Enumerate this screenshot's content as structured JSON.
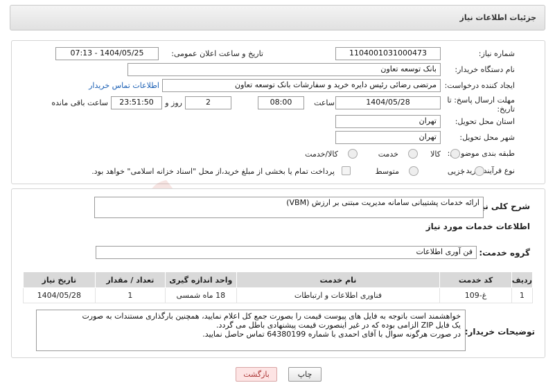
{
  "header": {
    "title": "جزئیات اطلاعات نیاز"
  },
  "form": {
    "need_number_label": "شماره نیاز:",
    "need_number": "1104001031000473",
    "announce_label": "تاریخ و ساعت اعلان عمومی:",
    "announce_value": "1404/05/25 - 07:13",
    "buyer_org_label": "نام دستگاه خریدار:",
    "buyer_org": "بانک توسعه تعاون",
    "requester_label": "ایجاد کننده درخواست:",
    "requester": "مرتضی رضائی رئیس دایره خرید و سفارشات بانک توسعه تعاون",
    "contact_link": "اطلاعات تماس خریدار",
    "deadline_label_1": "مهلت ارسال پاسخ: تا",
    "deadline_label_2": "تاریخ:",
    "deadline_date": "1404/05/28",
    "time_label": "ساعت",
    "deadline_time": "08:00",
    "days_value": "2",
    "days_label": "روز و",
    "remaining_time": "23:51:50",
    "remaining_label": "ساعت باقی مانده",
    "province_label": "استان محل تحویل:",
    "province": "تهران",
    "city_label": "شهر محل تحویل:",
    "city": "تهران",
    "category_label": "طبقه بندی موضوعی:",
    "category_options": [
      "کالا",
      "خدمت",
      "کالا/خدمت"
    ],
    "process_label": "نوع فرآیند خرید :",
    "process_options": [
      "جزیی",
      "متوسط"
    ],
    "payment_text": "پرداخت تمام یا بخشی از مبلغ خرید،از محل \"اسناد خزانه اسلامی\" خواهد بود."
  },
  "details": {
    "general_desc_label": "شرح کلی نیاز:",
    "general_desc": "ارائه خدمات پشتیبانی سامانه مدیریت مبتنی بر ارزش (VBM)",
    "services_info_title": "اطلاعات خدمات مورد نیاز",
    "service_group_label": "گروه خدمت:",
    "service_group": "فن آوری اطلاعات"
  },
  "table": {
    "headers": [
      "ردیف",
      "کد خدمت",
      "نام خدمت",
      "واحد اندازه گیری",
      "تعداد / مقدار",
      "تاریخ نیاز"
    ],
    "rows": [
      [
        "1",
        "غ-109",
        "فناوری اطلاعات و ارتباطات",
        "18 ماه شمسی",
        "1",
        "1404/05/28"
      ]
    ]
  },
  "notes": {
    "label": "توضیحات خریدار:",
    "line1": "خواهشمند است باتوجه به فایل های پیوست قیمت را بصورت جمع کل اعلام نمایید، همچنین بارگذاری مستندات به صورت",
    "line2": "یک فایل ZIP الزامی بوده که در غیر اینصورت قیمت پیشنهادی باطل می گردد.",
    "line3": "در صورت هرگونه سوال با آقای احمدی با شماره 64380199 تماس حاصل نمایید."
  },
  "buttons": {
    "print": "چاپ",
    "back": "بازگشت"
  },
  "watermark": {
    "text": "AriaTender.neT"
  }
}
